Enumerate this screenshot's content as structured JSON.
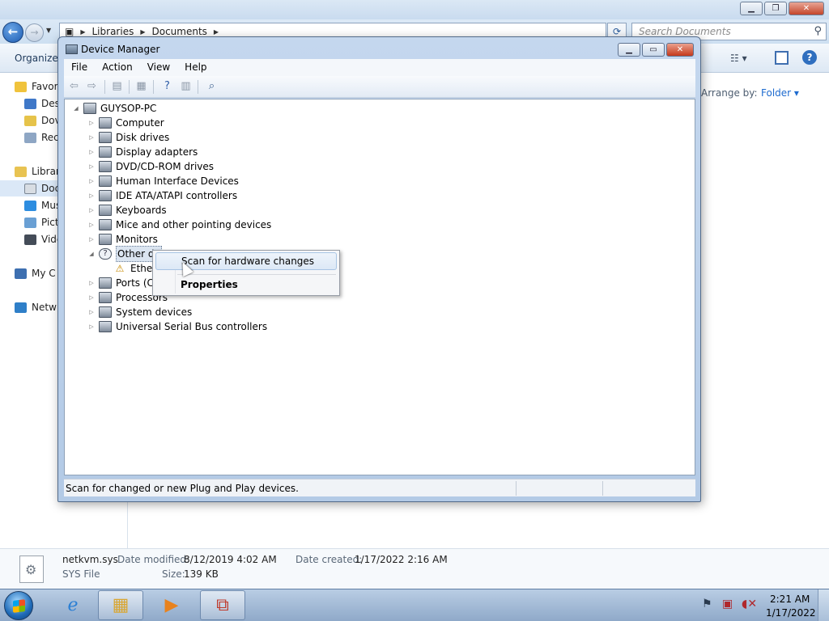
{
  "explorer": {
    "breadcrumb": [
      "Libraries",
      "Documents"
    ],
    "search_placeholder": "Search Documents",
    "toolbar": {
      "organize": "Organize"
    },
    "arrange_by_label": "Arrange by:",
    "arrange_by_value": "Folder",
    "nav": [
      {
        "label": "Favor",
        "color": "#f0c33c"
      },
      {
        "label": "Des",
        "color": "#3f78c8"
      },
      {
        "label": "Dov",
        "color": "#e6c34a"
      },
      {
        "label": "Rec",
        "color": "#8ea6c4"
      },
      {
        "label": "Librar",
        "color": "#e8c352"
      },
      {
        "label": "Doc",
        "color": "#d8dde3"
      },
      {
        "label": "Mus",
        "color": "#2d8de0"
      },
      {
        "label": "Pict",
        "color": "#6aa0d4"
      },
      {
        "label": "Vide",
        "color": "#444c58"
      },
      {
        "label": "My C",
        "color": "#3d6fb0"
      },
      {
        "label": "Netw",
        "color": "#2f7fc8"
      }
    ],
    "details": {
      "filename": "netkvm.sys",
      "filetype": "SYS File",
      "date_modified_label": "Date modified:",
      "date_modified": "8/12/2019 4:02 AM",
      "date_created_label": "Date created:",
      "date_created": "1/17/2022 2:16 AM",
      "size_label": "Size:",
      "size": "139 KB"
    }
  },
  "device_manager": {
    "title": "Device Manager",
    "menu": [
      "File",
      "Action",
      "View",
      "Help"
    ],
    "tree": {
      "root": "GUYSOP-PC",
      "items": [
        "Computer",
        "Disk drives",
        "Display adapters",
        "DVD/CD-ROM drives",
        "Human Interface Devices",
        "IDE ATA/ATAPI controllers",
        "Keyboards",
        "Mice and other pointing devices",
        "Monitors",
        "Other de",
        "Ether",
        "Ports (CO",
        "Processors",
        "System devices",
        "Universal Serial Bus controllers"
      ]
    },
    "status": "Scan for changed or new Plug and Play devices."
  },
  "context_menu": {
    "items": [
      "Scan for hardware changes",
      "Properties"
    ]
  },
  "taskbar": {
    "time": "2:21 AM",
    "date": "1/17/2022"
  }
}
